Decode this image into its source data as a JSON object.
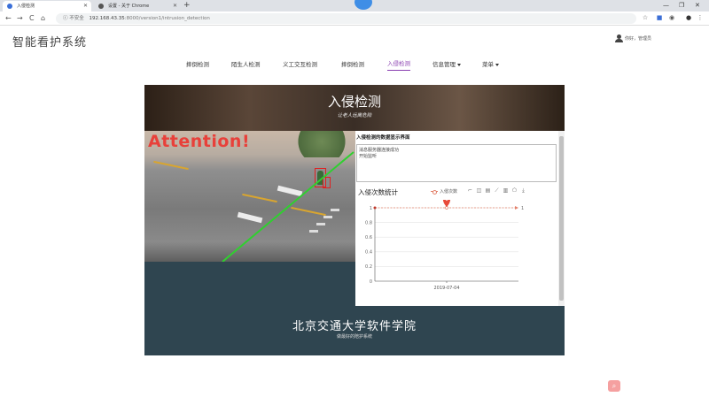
{
  "browser": {
    "tabs": [
      {
        "title": "入侵检测",
        "active": true
      },
      {
        "title": "设置 - 关于 Chrome",
        "active": false
      }
    ],
    "new_tab": "+",
    "window_controls": [
      "—",
      "❐",
      "✕"
    ],
    "nav": [
      "←",
      "→",
      "C",
      "⌂"
    ],
    "security_label": "不安全",
    "url_host": "192.168.43.35",
    "url_path": ":8000/version1/intrusion_detection"
  },
  "site": {
    "title": "智能看护系统",
    "user_label": "你好，管理员"
  },
  "nav": {
    "items": [
      {
        "label": "摔倒检测",
        "active": false,
        "dropdown": false
      },
      {
        "label": "陌生人检测",
        "active": false,
        "dropdown": false
      },
      {
        "label": "义工交互检测",
        "active": false,
        "dropdown": false
      },
      {
        "label": "摔倒检测",
        "active": false,
        "dropdown": false
      },
      {
        "label": "入侵检测",
        "active": true,
        "dropdown": false
      },
      {
        "label": "信息管理",
        "active": false,
        "dropdown": true
      },
      {
        "label": "菜单",
        "active": false,
        "dropdown": true
      }
    ]
  },
  "banner": {
    "title": "入侵检测",
    "subtitle": "让老人远离危险"
  },
  "camera": {
    "alert_text": "Attention!"
  },
  "panel": {
    "title": "入侵检测的数据显示界面",
    "messages": [
      "消息服务器连接成功",
      "开始监听"
    ],
    "stats_title": "入侵次数统计",
    "legend_label": "入侵次数"
  },
  "chart_data": {
    "type": "line",
    "categories": [
      "2019-07-04"
    ],
    "series": [
      {
        "name": "入侵次数",
        "values": [
          1
        ]
      }
    ],
    "yticks": [
      "0",
      "0.2",
      "0.4",
      "0.6",
      "0.8",
      "1"
    ],
    "ylim": [
      0,
      1
    ],
    "max_marker": "1",
    "markline_label": "1",
    "colors": {
      "series": "#e3806a",
      "marker": "#e84a3a"
    }
  },
  "footer": {
    "title": "北京交通大学软件学院",
    "subtitle": "做最好的陪护系统"
  }
}
